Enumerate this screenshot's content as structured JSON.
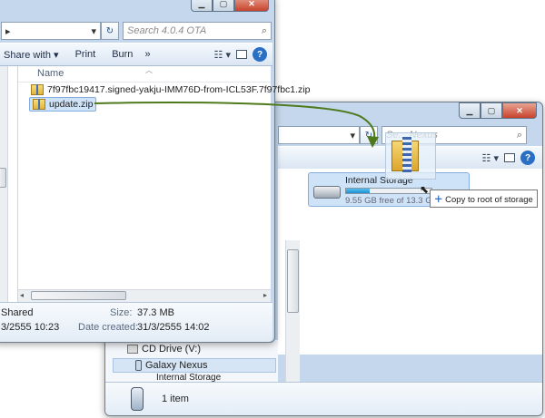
{
  "front_window": {
    "search_placeholder": "Search 4.0.4 OTA",
    "toolbar": {
      "share_with": "Share with",
      "print": "Print",
      "burn": "Burn",
      "more": "»"
    },
    "column_header": "Name",
    "files": [
      {
        "name": "7f97fbc19417.signed-yakju-IMM76D-from-ICL53F.7f97fbc1.zip"
      },
      {
        "name": "update.zip"
      }
    ],
    "details": {
      "shared_label": "Shared",
      "modified": "3/2555 10:23",
      "size_label": "Size:",
      "size_value": "37.3 MB",
      "created_label": "Date created:",
      "created_value": "31/3/2555 14:02"
    }
  },
  "back_window": {
    "search_placeholder": "Se... Nexus",
    "drive": {
      "name": "Internal Storage",
      "free_text": "9.55 GB free of 13.3 GB",
      "used_fraction": 0.28
    },
    "drag_tooltip": "Copy to root of storage",
    "nav_items": [
      "CD Drive (V:)",
      "Galaxy Nexus",
      "Internal Storage"
    ],
    "status": "1 item"
  },
  "colors": {
    "drag_arrow": "#4e7a1c",
    "selection": "#cfe3f8"
  }
}
